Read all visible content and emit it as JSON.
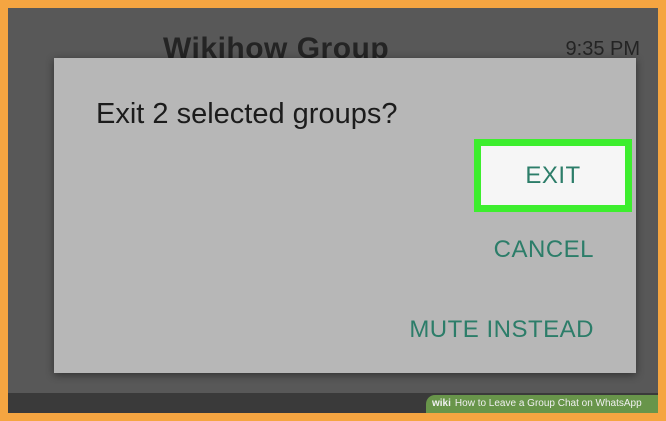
{
  "background_chat": {
    "title": "Wikihow Group",
    "time": "9:35 PM"
  },
  "dialog": {
    "title": "Exit 2 selected groups?",
    "actions": {
      "exit": "EXIT",
      "cancel": "CANCEL",
      "mute": "MUTE INSTEAD"
    }
  },
  "watermark": {
    "badge": "wiki",
    "text": "How to Leave a Group Chat on WhatsApp"
  },
  "colors": {
    "frame": "#f5a541",
    "dim_background": "#585858",
    "dialog": "#b7b7b7",
    "action_text": "#2c7d69",
    "highlight": "#3dee2e"
  }
}
